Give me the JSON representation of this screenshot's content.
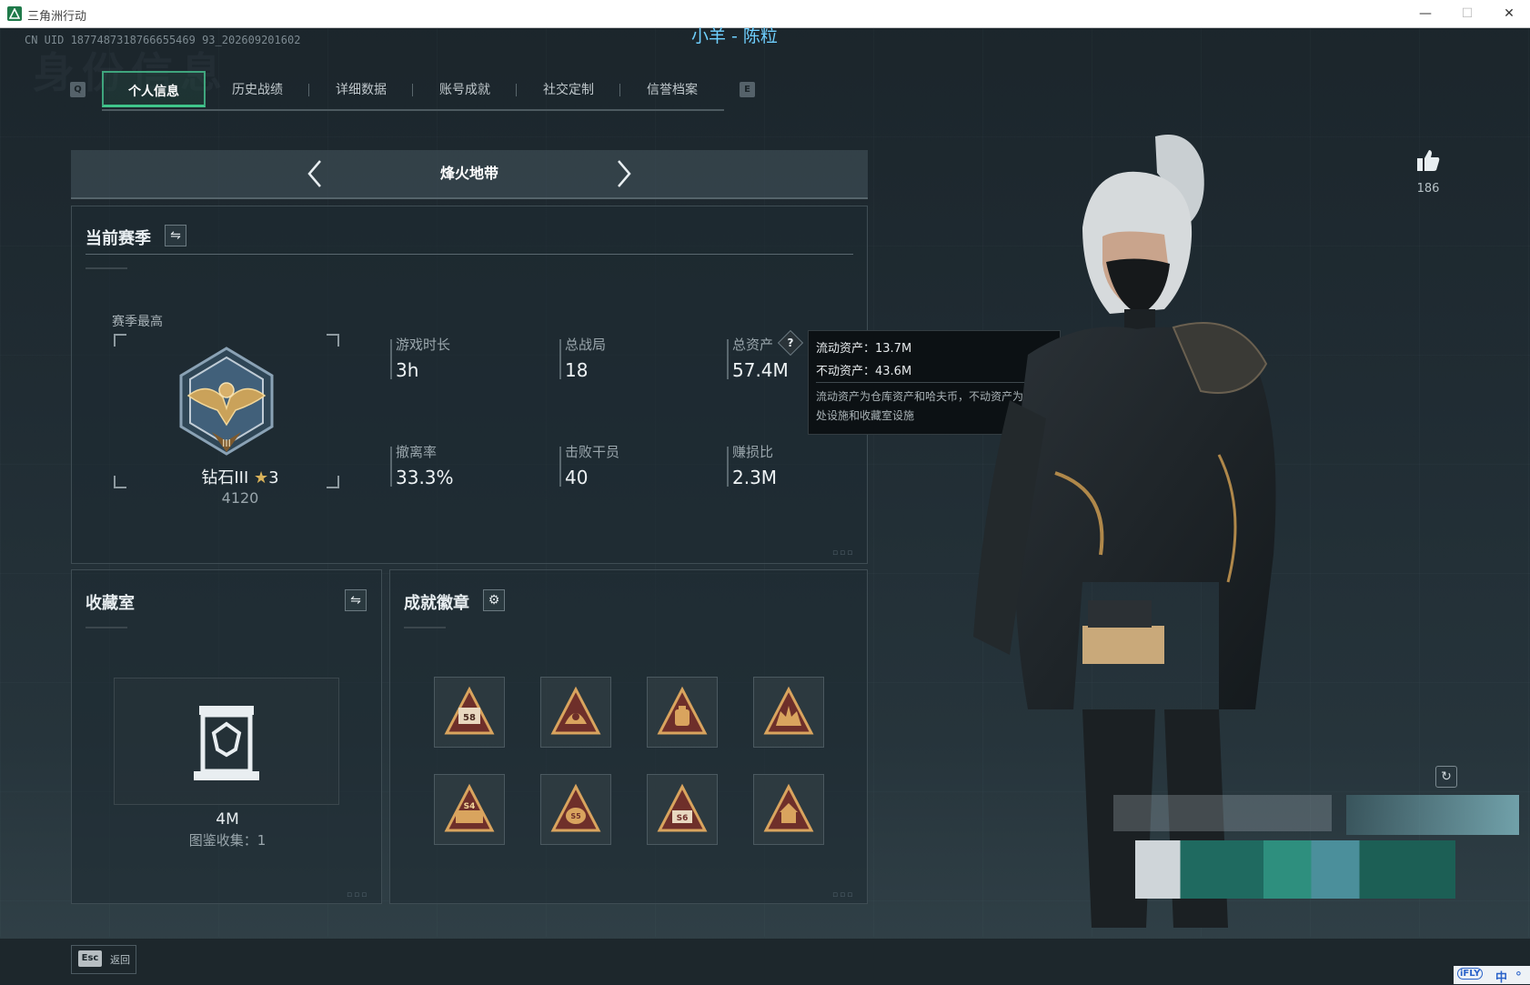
{
  "window": {
    "title": "三角洲行动",
    "minimize_label": "—",
    "maximize_label": "☐",
    "close_label": "✕"
  },
  "header": {
    "uid": "CN UID 1877487318766655469 93_202609201602",
    "player_name": "小羊 - 陈粒",
    "ghost_title": "身份信息"
  },
  "tabs": {
    "left_key": "Q",
    "right_key": "E",
    "items": [
      {
        "label": "个人信息",
        "active": true
      },
      {
        "label": "历史战绩",
        "active": false
      },
      {
        "label": "详细数据",
        "active": false
      },
      {
        "label": "账号成就",
        "active": false
      },
      {
        "label": "社交定制",
        "active": false
      },
      {
        "label": "信誉档案",
        "active": false
      }
    ]
  },
  "mode_selector": {
    "label": "烽火地带"
  },
  "season": {
    "title": "当前赛季",
    "best_label": "赛季最高",
    "rank_name": "钻石III",
    "rank_stars": "3",
    "rank_points": "4120",
    "stats": [
      {
        "label": "游戏时长",
        "value": "3h"
      },
      {
        "label": "总战局",
        "value": "18"
      },
      {
        "label": "总资产",
        "value": "57.4M"
      },
      {
        "label": "撤离率",
        "value": "33.3%"
      },
      {
        "label": "击败干员",
        "value": "40"
      },
      {
        "label": "赚损比",
        "value": "2.3M"
      }
    ]
  },
  "tooltip": {
    "liquid": "流动资产：13.7M",
    "fixed": "不动资产：43.6M",
    "description": "流动资产为仓库资产和哈夫币，不动资产为特勤处设施和收藏室设施"
  },
  "collection": {
    "title": "收藏室",
    "value": "4M",
    "count_text": "图鉴收集：1"
  },
  "achievements": {
    "title": "成就徽章",
    "badges": [
      {
        "icon": "s8-badge-icon",
        "text": "58"
      },
      {
        "icon": "helmet-badge-icon",
        "text": ""
      },
      {
        "icon": "backpack-badge-icon",
        "text": ""
      },
      {
        "icon": "beast-badge-icon",
        "text": ""
      },
      {
        "icon": "s4-badge-icon",
        "text": "S4"
      },
      {
        "icon": "s5-badge-icon",
        "text": "S5"
      },
      {
        "icon": "s6-badge-icon",
        "text": "S6"
      },
      {
        "icon": "house-badge-icon",
        "text": ""
      }
    ]
  },
  "likes": {
    "count": "186"
  },
  "footer": {
    "esc_key": "Esc",
    "esc_label": "返回"
  },
  "ime": {
    "lang": "中"
  },
  "colors": {
    "accent_green": "#3fc58a",
    "name_blue": "#6fd0ff",
    "background": "#202c33"
  }
}
